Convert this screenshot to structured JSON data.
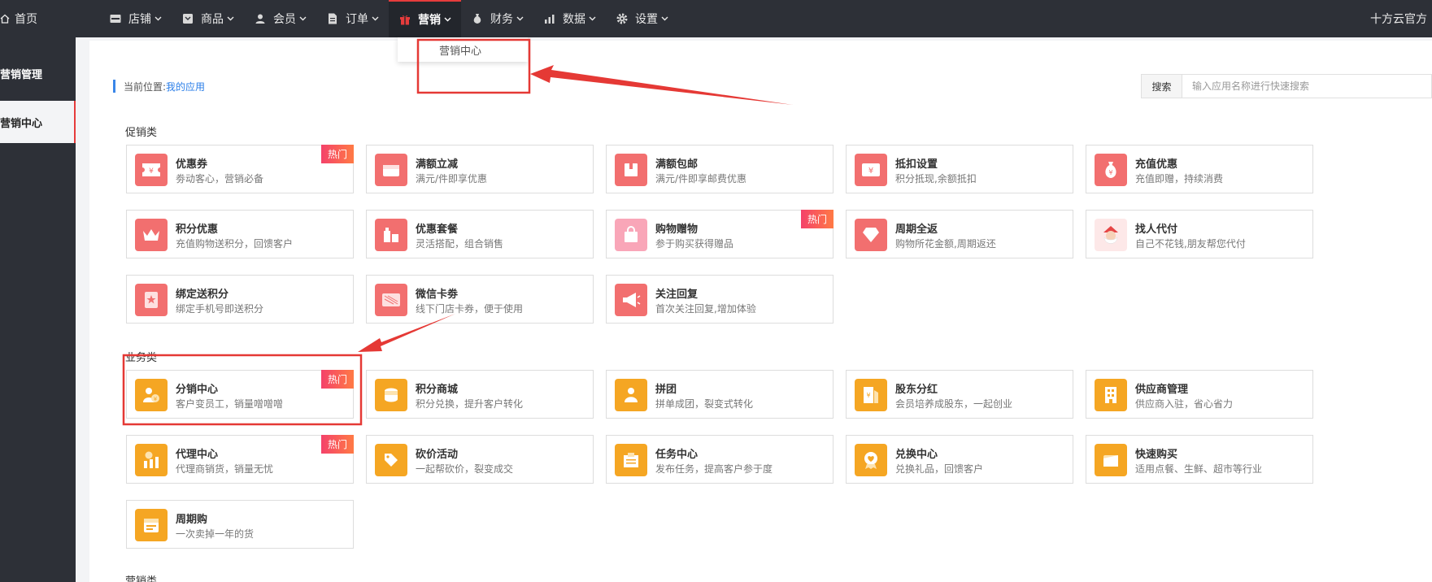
{
  "nav": {
    "home": "首页",
    "menu": [
      {
        "id": "store",
        "label": "店铺",
        "icon": "store-icon"
      },
      {
        "id": "goods",
        "label": "商品",
        "icon": "goods-icon"
      },
      {
        "id": "member",
        "label": "会员",
        "icon": "user-icon"
      },
      {
        "id": "order",
        "label": "订单",
        "icon": "document-icon"
      },
      {
        "id": "marketing",
        "label": "营销",
        "icon": "gift-icon",
        "active": true
      },
      {
        "id": "finance",
        "label": "财务",
        "icon": "money-bag-icon"
      },
      {
        "id": "data",
        "label": "数据",
        "icon": "bar-chart-icon"
      },
      {
        "id": "settings",
        "label": "设置",
        "icon": "gear-icon"
      }
    ],
    "right_text": "十方云官方"
  },
  "dropdown": {
    "item": "营销中心"
  },
  "sidebar": {
    "items": [
      {
        "label": "营销管理"
      },
      {
        "label": "营销中心",
        "active": true
      }
    ]
  },
  "breadcrumb": {
    "prefix": "当前位置:",
    "link": "我的应用"
  },
  "search": {
    "label": "搜索",
    "placeholder": "输入应用名称进行快速搜索"
  },
  "sections": [
    {
      "title": "促销类"
    },
    {
      "title": "业务类"
    },
    {
      "title": "营销类"
    }
  ],
  "hot_label": "热门",
  "cards": {
    "promo": [
      {
        "title": "优惠券",
        "desc": "劵动客心，营销必备",
        "hot": true,
        "icon": "coupon-icon"
      },
      {
        "title": "满额立减",
        "desc": "满元/件即享优惠",
        "icon": "wallet-icon"
      },
      {
        "title": "满额包邮",
        "desc": "满元/件即享邮费优惠",
        "icon": "box-icon"
      },
      {
        "title": "抵扣设置",
        "desc": "积分抵现,余额抵扣",
        "icon": "yuan-ticket-icon"
      },
      {
        "title": "充值优惠",
        "desc": "充值即赠，持续消费",
        "icon": "money-bag-icon"
      },
      {
        "title": "积分优惠",
        "desc": "充值购物送积分，回馈客户",
        "icon": "crown-icon"
      },
      {
        "title": "优惠套餐",
        "desc": "灵活搭配，组合销售",
        "icon": "package-icon"
      },
      {
        "title": "购物赠物",
        "desc": "参于购买获得赠品",
        "hot": true,
        "icon": "shopping-bag-icon"
      },
      {
        "title": "周期全返",
        "desc": "购物所花金额,周期返还",
        "icon": "diamond-icon"
      },
      {
        "title": "找人代付",
        "desc": "自己不花钱,朋友帮您代付",
        "icon": "santa-icon"
      },
      {
        "title": "绑定送积分",
        "desc": "绑定手机号即送积分",
        "icon": "star-card-icon"
      },
      {
        "title": "微信卡劵",
        "desc": "线下门店卡券，便于使用",
        "icon": "card-icon"
      },
      {
        "title": "关注回复",
        "desc": "首次关注回复,增加体验",
        "icon": "megaphone-icon"
      }
    ],
    "business": [
      {
        "title": "分销中心",
        "desc": "客户变员工，销量噌噌噌",
        "hot": true,
        "icon": "distributor-icon"
      },
      {
        "title": "积分商城",
        "desc": "积分兑换，提升客户转化",
        "icon": "coins-icon"
      },
      {
        "title": "拼团",
        "desc": "拼单成团，裂变式转化",
        "icon": "group-icon"
      },
      {
        "title": "股东分红",
        "desc": "会员培养成股东，一起创业",
        "icon": "dividend-icon"
      },
      {
        "title": "供应商管理",
        "desc": "供应商入驻，省心省力",
        "icon": "building-icon"
      },
      {
        "title": "代理中心",
        "desc": "代理商销货，销量无忧",
        "hot": true,
        "icon": "agent-chart-icon"
      },
      {
        "title": "砍价活动",
        "desc": "一起帮砍价，裂变成交",
        "icon": "bargain-icon"
      },
      {
        "title": "任务中心",
        "desc": "发布任务，提高客户参于度",
        "icon": "task-icon"
      },
      {
        "title": "兑换中心",
        "desc": "兑换礼品，回馈客户",
        "icon": "heart-badge-icon"
      },
      {
        "title": "快速购买",
        "desc": "适用点餐、生鲜、超市等行业",
        "icon": "quick-buy-icon"
      },
      {
        "title": "周期购",
        "desc": "一次卖掉一年的货",
        "icon": "calendar-icon"
      }
    ]
  },
  "colors": {
    "accent_red": "#e63c3c",
    "link_blue": "#2a7ee8",
    "icon_red": "#f26f6f",
    "icon_orange": "#f5a623",
    "topbar": "#2d3037"
  }
}
